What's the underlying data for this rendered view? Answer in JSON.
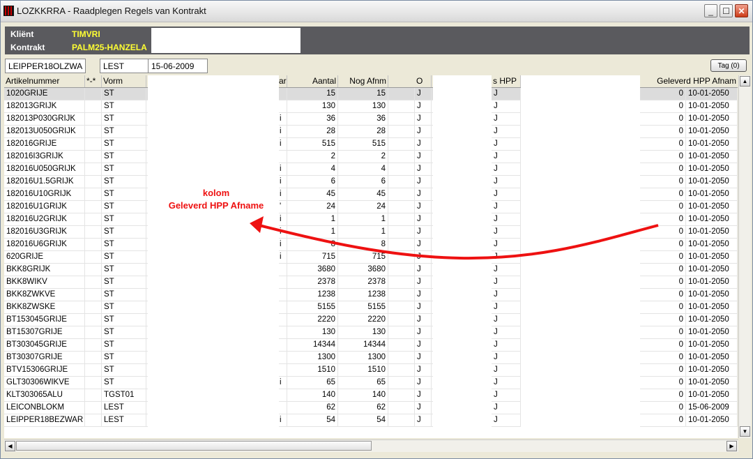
{
  "window": {
    "title": "LOZKKRRA - Raadplegen Regels van Kontrakt",
    "minimize_glyph": "_",
    "maximize_glyph": "☐",
    "close_glyph": "✕"
  },
  "header": {
    "client_label": "Kliënt",
    "client_value": "TIMVRI",
    "contract_label": "Kontrakt",
    "contract_value": "PALM25-HANZELA"
  },
  "filter": {
    "article": "LEIPPER18OLZWA",
    "form": "LEST",
    "date": "15-06-2009",
    "tag_button": "Tag (0)"
  },
  "columns": {
    "artikelnummer": "Artikelnummer",
    "star": "*-*",
    "vorm": "Vorm",
    "partial_ar": "ar",
    "aantal": "Aantal",
    "nog_afnm": "Nog Afnm",
    "o": "O",
    "s_hpp": "s HPP",
    "partial_s": "s",
    "geleverd_hpp_afnam": "Geleverd HPP Afnam"
  },
  "rows": [
    {
      "art": "1020GRIJE",
      "vorm": "ST",
      "frag": "",
      "aantal": "15",
      "nog": "15",
      "o": "J",
      "hpp": "J",
      "gel": "0",
      "date": "10-01-2050"
    },
    {
      "art": "182013GRIJK",
      "vorm": "ST",
      "frag": "",
      "aantal": "130",
      "nog": "130",
      "o": "J",
      "hpp": "J",
      "gel": "0",
      "date": "10-01-2050"
    },
    {
      "art": "182013P030GRIJK",
      "vorm": "ST",
      "frag": "i",
      "aantal": "36",
      "nog": "36",
      "o": "J",
      "hpp": "J",
      "gel": "0",
      "date": "10-01-2050"
    },
    {
      "art": "182013U050GRIJK",
      "vorm": "ST",
      "frag": "i",
      "aantal": "28",
      "nog": "28",
      "o": "J",
      "hpp": "J",
      "gel": "0",
      "date": "10-01-2050"
    },
    {
      "art": "182016GRIJE",
      "vorm": "ST",
      "frag": "i",
      "aantal": "515",
      "nog": "515",
      "o": "J",
      "hpp": "J",
      "gel": "0",
      "date": "10-01-2050"
    },
    {
      "art": "182016I3GRIJK",
      "vorm": "ST",
      "frag": "",
      "aantal": "2",
      "nog": "2",
      "o": "J",
      "hpp": "J",
      "gel": "0",
      "date": "10-01-2050"
    },
    {
      "art": "182016U050GRIJK",
      "vorm": "ST",
      "frag": "i",
      "aantal": "4",
      "nog": "4",
      "o": "J",
      "hpp": "J",
      "gel": "0",
      "date": "10-01-2050"
    },
    {
      "art": "182016U1.5GRIJK",
      "vorm": "ST",
      "frag": "i",
      "aantal": "6",
      "nog": "6",
      "o": "J",
      "hpp": "J",
      "gel": "0",
      "date": "10-01-2050"
    },
    {
      "art": "182016U10GRIJK",
      "vorm": "ST",
      "frag": "i",
      "aantal": "45",
      "nog": "45",
      "o": "J",
      "hpp": "J",
      "gel": "0",
      "date": "10-01-2050"
    },
    {
      "art": "182016U1GRIJK",
      "vorm": "ST",
      "frag": "'",
      "aantal": "24",
      "nog": "24",
      "o": "J",
      "hpp": "J",
      "gel": "0",
      "date": "10-01-2050"
    },
    {
      "art": "182016U2GRIJK",
      "vorm": "ST",
      "frag": "i",
      "aantal": "1",
      "nog": "1",
      "o": "J",
      "hpp": "J",
      "gel": "0",
      "date": "10-01-2050"
    },
    {
      "art": "182016U3GRIJK",
      "vorm": "ST",
      "frag": "i",
      "aantal": "1",
      "nog": "1",
      "o": "J",
      "hpp": "J",
      "gel": "0",
      "date": "10-01-2050"
    },
    {
      "art": "182016U6GRIJK",
      "vorm": "ST",
      "frag": "i",
      "aantal": "8",
      "nog": "8",
      "o": "J",
      "hpp": "J",
      "gel": "0",
      "date": "10-01-2050"
    },
    {
      "art": "620GRIJE",
      "vorm": "ST",
      "frag": "i",
      "aantal": "715",
      "nog": "715",
      "o": "J",
      "hpp": "J",
      "gel": "0",
      "date": "10-01-2050"
    },
    {
      "art": "BKK8GRIJK",
      "vorm": "ST",
      "frag": "",
      "aantal": "3680",
      "nog": "3680",
      "o": "J",
      "hpp": "J",
      "gel": "0",
      "date": "10-01-2050"
    },
    {
      "art": "BKK8WIKV",
      "vorm": "ST",
      "frag": "",
      "aantal": "2378",
      "nog": "2378",
      "o": "J",
      "hpp": "J",
      "gel": "0",
      "date": "10-01-2050"
    },
    {
      "art": "BKK8ZWKVE",
      "vorm": "ST",
      "frag": "",
      "aantal": "1238",
      "nog": "1238",
      "o": "J",
      "hpp": "J",
      "gel": "0",
      "date": "10-01-2050"
    },
    {
      "art": "BKK8ZWSKE",
      "vorm": "ST",
      "frag": "",
      "aantal": "5155",
      "nog": "5155",
      "o": "J",
      "hpp": "J",
      "gel": "0",
      "date": "10-01-2050"
    },
    {
      "art": "BT153045GRIJE",
      "vorm": "ST",
      "frag": "",
      "aantal": "2220",
      "nog": "2220",
      "o": "J",
      "hpp": "J",
      "gel": "0",
      "date": "10-01-2050"
    },
    {
      "art": "BT15307GRIJE",
      "vorm": "ST",
      "frag": "",
      "aantal": "130",
      "nog": "130",
      "o": "J",
      "hpp": "J",
      "gel": "0",
      "date": "10-01-2050"
    },
    {
      "art": "BT303045GRIJE",
      "vorm": "ST",
      "frag": "",
      "aantal": "14344",
      "nog": "14344",
      "o": "J",
      "hpp": "J",
      "gel": "0",
      "date": "10-01-2050"
    },
    {
      "art": "BT30307GRIJE",
      "vorm": "ST",
      "frag": "",
      "aantal": "1300",
      "nog": "1300",
      "o": "J",
      "hpp": "J",
      "gel": "0",
      "date": "10-01-2050"
    },
    {
      "art": "BTV15306GRIJE",
      "vorm": "ST",
      "frag": "",
      "aantal": "1510",
      "nog": "1510",
      "o": "J",
      "hpp": "J",
      "gel": "0",
      "date": "10-01-2050"
    },
    {
      "art": "GLT30306WIKVE",
      "vorm": "ST",
      "frag": "i",
      "aantal": "65",
      "nog": "65",
      "o": "J",
      "hpp": "J",
      "gel": "0",
      "date": "10-01-2050"
    },
    {
      "art": "KLT303065ALU",
      "vorm": "TGST01",
      "frag": "",
      "aantal": "140",
      "nog": "140",
      "o": "J",
      "hpp": "J",
      "gel": "0",
      "date": "10-01-2050"
    },
    {
      "art": "LEICONBLOKM",
      "vorm": "LEST",
      "frag": "",
      "aantal": "62",
      "nog": "62",
      "o": "J",
      "hpp": "J",
      "gel": "0",
      "date": "15-06-2009"
    },
    {
      "art": "LEIPPER18BEZWAR",
      "vorm": "LEST",
      "frag": "i",
      "aantal": "54",
      "nog": "54",
      "o": "J",
      "hpp": "J",
      "gel": "0",
      "date": "10-01-2050"
    }
  ],
  "annotation": {
    "line1": "kolom",
    "line2": "Geleverd HPP Afname",
    "color": "#ee1111"
  },
  "scroll": {
    "up": "▲",
    "down": "▼",
    "left": "◀",
    "right": "▶"
  }
}
